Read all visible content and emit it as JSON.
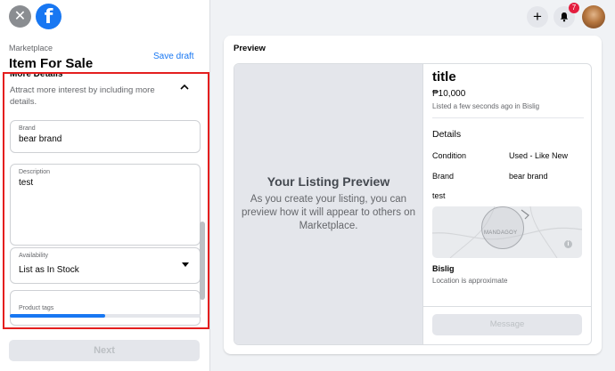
{
  "left": {
    "breadcrumb": "Marketplace",
    "title": "Item For Sale",
    "save_draft": "Save draft",
    "more_details": {
      "heading": "More Details",
      "subtitle": "Attract more interest by including more details."
    },
    "brand": {
      "label": "Brand",
      "value": "bear brand"
    },
    "description": {
      "label": "Description",
      "value": "test"
    },
    "availability": {
      "label": "Availability",
      "value": "List as In Stock"
    },
    "next_field": {
      "label": "Product tags"
    },
    "progress": 0.5,
    "next_button": "Next"
  },
  "topbar": {
    "notification_count": "7"
  },
  "preview": {
    "label": "Preview",
    "placeholder_title": "Your Listing Preview",
    "placeholder_text": "As you create your listing, you can preview how it will appear to others on Marketplace.",
    "listing_title": "title",
    "price": "₱10,000",
    "listed": "Listed a few seconds ago in Bislig",
    "details_heading": "Details",
    "details": [
      {
        "key": "Condition",
        "value": "Used - Like New"
      },
      {
        "key": "Brand",
        "value": "bear brand"
      }
    ],
    "description": "test",
    "map_label": "MANDAGOY",
    "location": "Bislig",
    "location_note": "Location is approximate",
    "message_button": "Message"
  },
  "colors": {
    "accent": "#1877f2",
    "highlight_border": "#e41e1e",
    "badge": "#e41e3f"
  }
}
